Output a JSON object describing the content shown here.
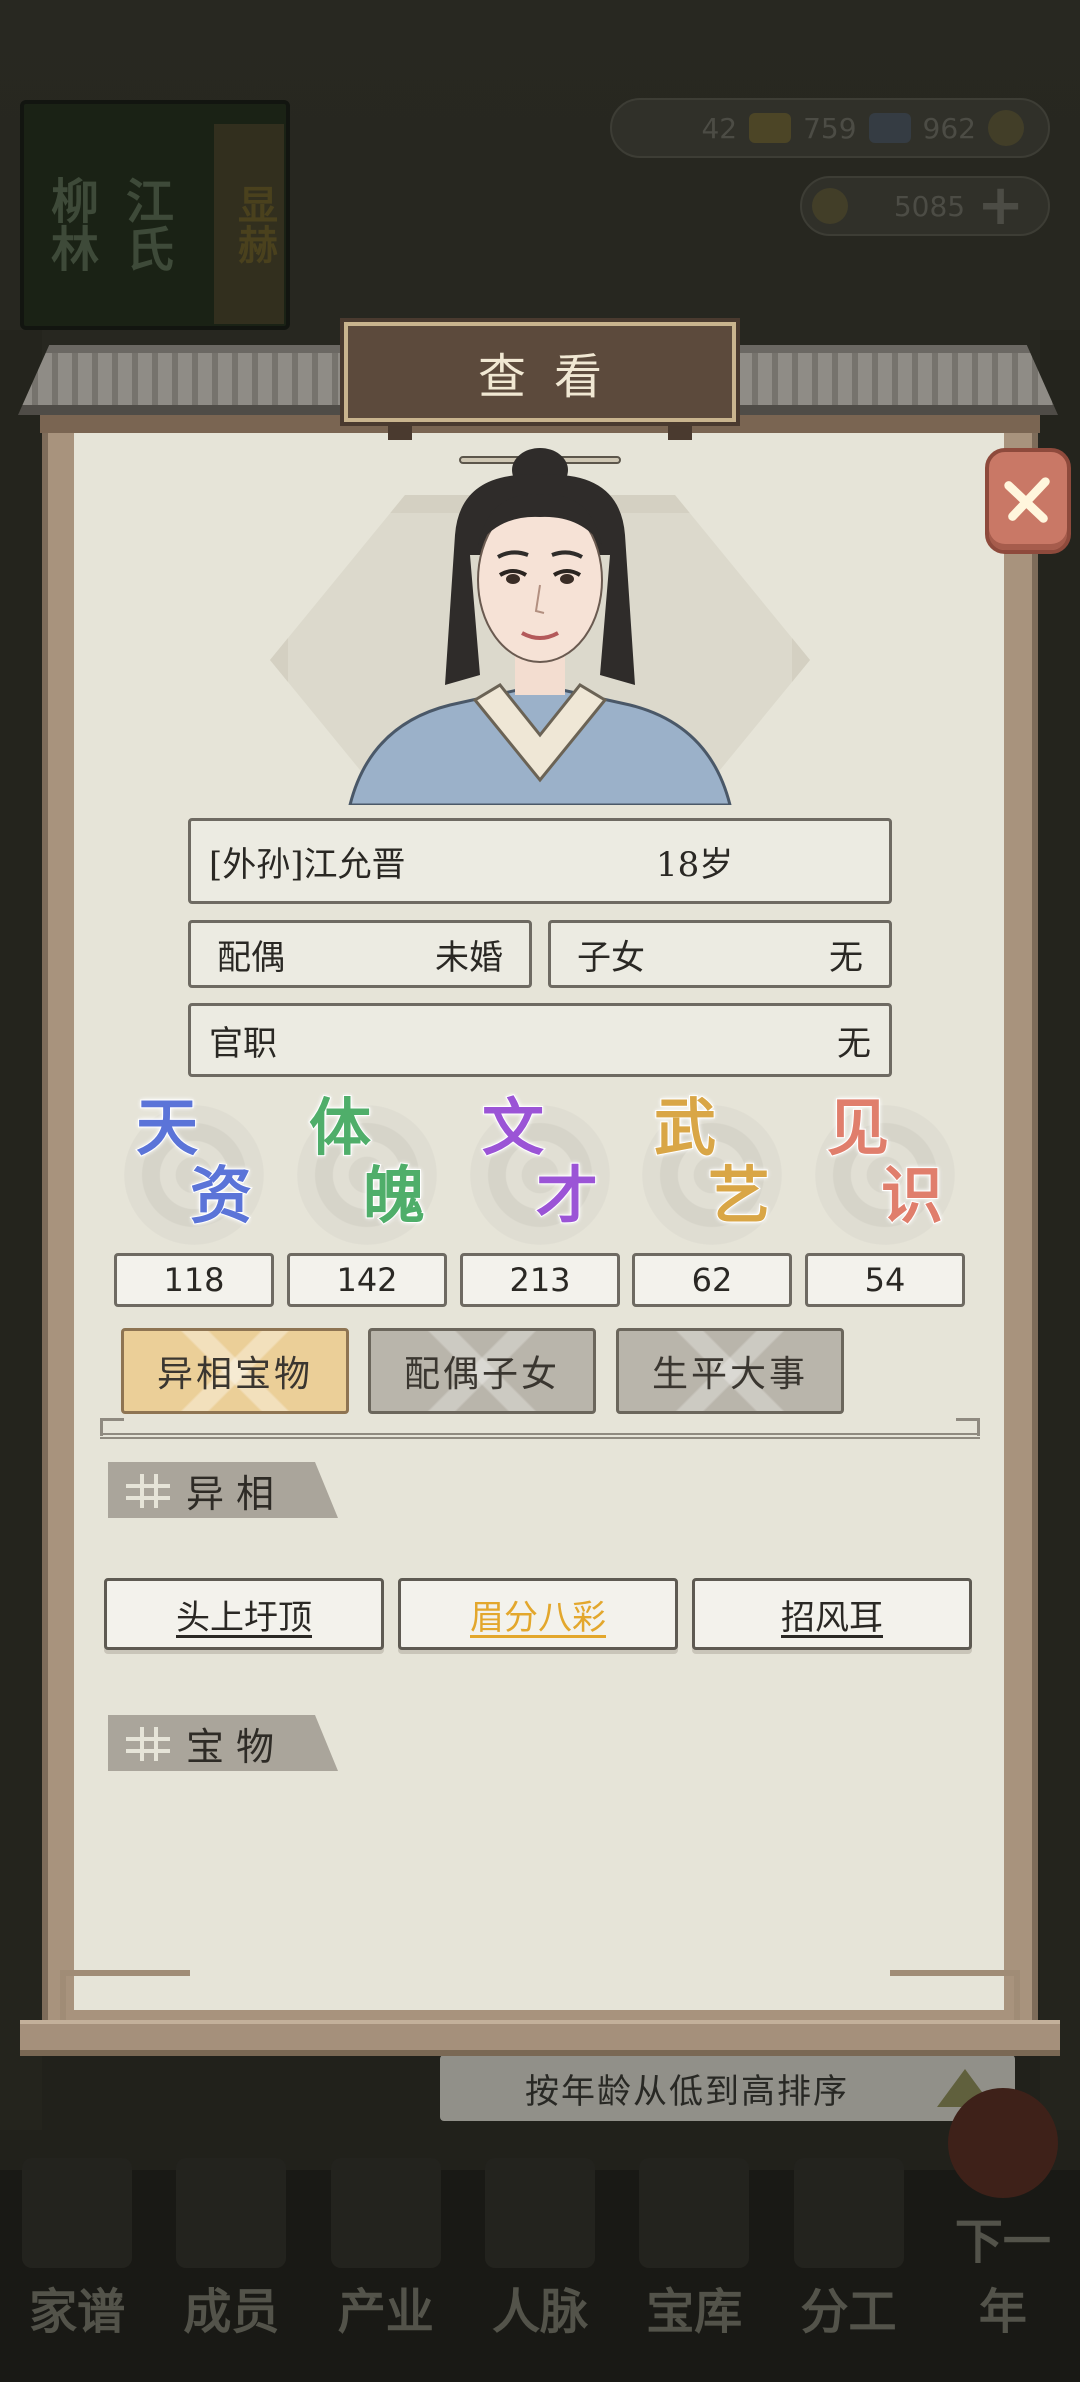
{
  "background": {
    "banner": {
      "chars_left": "柳林",
      "chars_mid": "江氏",
      "chars_right": "显赫"
    },
    "resources": {
      "gold": "42",
      "silver": "759",
      "coins": "962",
      "rice": "5085"
    },
    "sort_label": "按年龄从低到高排序",
    "nav": [
      {
        "label": "家谱"
      },
      {
        "label": "成员"
      },
      {
        "label": "产业"
      },
      {
        "label": "人脉"
      },
      {
        "label": "宝库"
      },
      {
        "label": "分工"
      },
      {
        "label": "下一年"
      }
    ]
  },
  "modal": {
    "title": "查看",
    "person": {
      "name": "[外孙]江允晋",
      "age": "18岁",
      "spouse_label": "配偶",
      "spouse_value": "未婚",
      "children_label": "子女",
      "children_value": "无",
      "office_label": "官职",
      "office_value": "无"
    },
    "stats": [
      {
        "c1": "天",
        "c2": "资",
        "value": "118",
        "color": "#5b74d8"
      },
      {
        "c1": "体",
        "c2": "魄",
        "value": "142",
        "color": "#4fae6a"
      },
      {
        "c1": "文",
        "c2": "才",
        "value": "213",
        "color": "#9b54d6"
      },
      {
        "c1": "武",
        "c2": "艺",
        "value": "62",
        "color": "#d9a646"
      },
      {
        "c1": "见",
        "c2": "识",
        "value": "54",
        "color": "#e07e6c"
      }
    ],
    "tabs": [
      "异相宝物",
      "配偶子女",
      "生平大事"
    ],
    "traits_heading": "异相",
    "traits": [
      "头上圩顶",
      "眉分八彩",
      "招风耳"
    ],
    "treasures_heading": "宝物"
  }
}
